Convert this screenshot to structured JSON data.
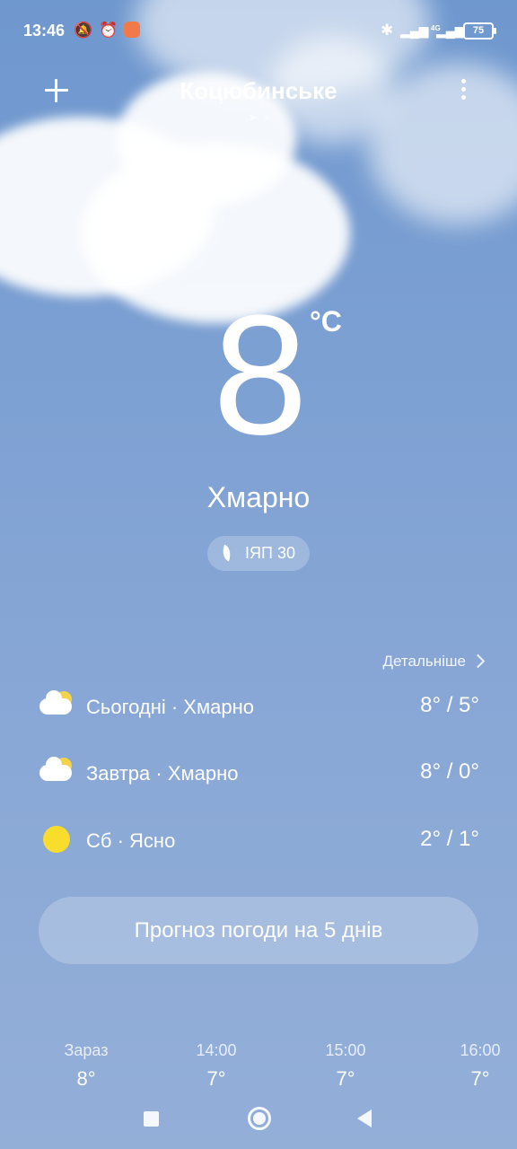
{
  "status_bar": {
    "time": "13:46",
    "icons": [
      "notifications-muted-icon",
      "alarm-icon",
      "app-notification-icon",
      "bluetooth-icon",
      "signal-icon",
      "signal-4g-icon"
    ],
    "network_label": "4G",
    "battery": "75"
  },
  "header": {
    "city": "Коцюбинське",
    "add_icon": "plus-icon",
    "menu_icon": "more-vertical-icon",
    "location_icon": "location-arrow-icon"
  },
  "current": {
    "temperature": "8",
    "unit": "°C",
    "condition": "Хмарно",
    "aqi_label": "ІЯП 30",
    "aqi_icon": "leaf-icon"
  },
  "daily": {
    "details_label": "Детальніше",
    "days": [
      {
        "label": "Сьогодні · Хмарно",
        "range": "8° / 5°",
        "icon": "partly-cloudy-icon"
      },
      {
        "label": "Завтра · Хмарно",
        "range": "8° / 0°",
        "icon": "partly-cloudy-icon"
      },
      {
        "label": "Сб · Ясно",
        "range": "2° / 1°",
        "icon": "sun-icon"
      }
    ]
  },
  "forecast_button": "Прогноз погоди на 5 днів",
  "hourly": [
    {
      "time": "Зараз",
      "temp": "8°"
    },
    {
      "time": "14:00",
      "temp": "7°"
    },
    {
      "time": "15:00",
      "temp": "7°"
    },
    {
      "time": "16:00",
      "temp": "7°"
    }
  ],
  "colors": {
    "sky_top": "#6f98cf",
    "sky_bottom": "#93afd8",
    "sun": "#f9dd2c"
  }
}
